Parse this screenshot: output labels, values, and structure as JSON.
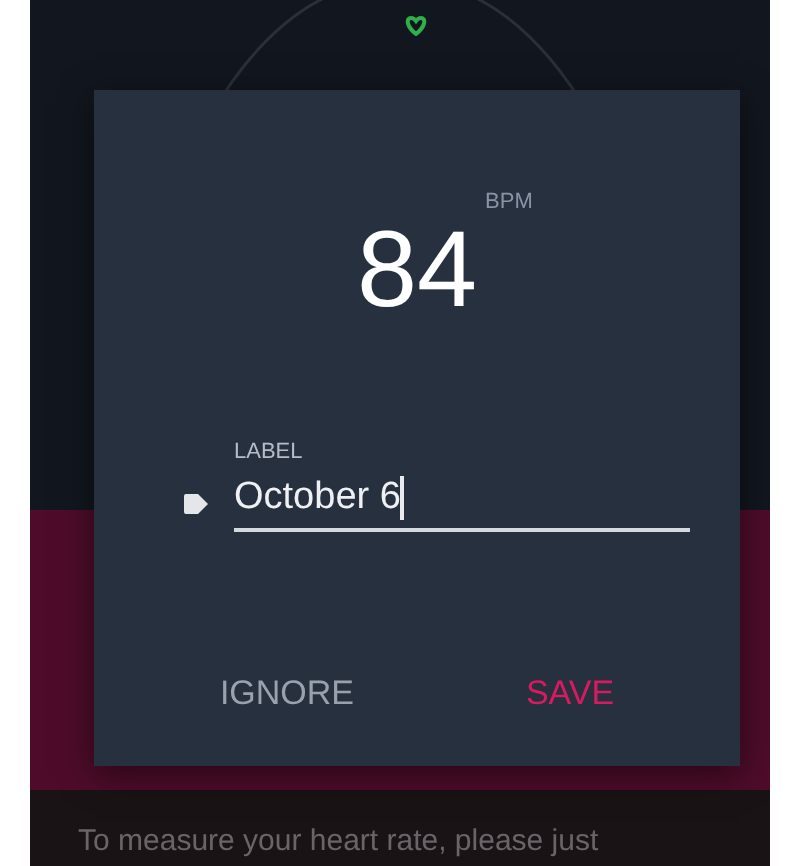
{
  "dialog": {
    "reading": {
      "value": "84",
      "unit": "BPM"
    },
    "field": {
      "label": "LABEL",
      "value": "October 6"
    },
    "buttons": [
      {
        "label": "IGNORE",
        "kind": "secondary"
      },
      {
        "label": "SAVE",
        "kind": "primary"
      }
    ]
  },
  "footer": {
    "text": "To measure your heart rate, please just"
  }
}
